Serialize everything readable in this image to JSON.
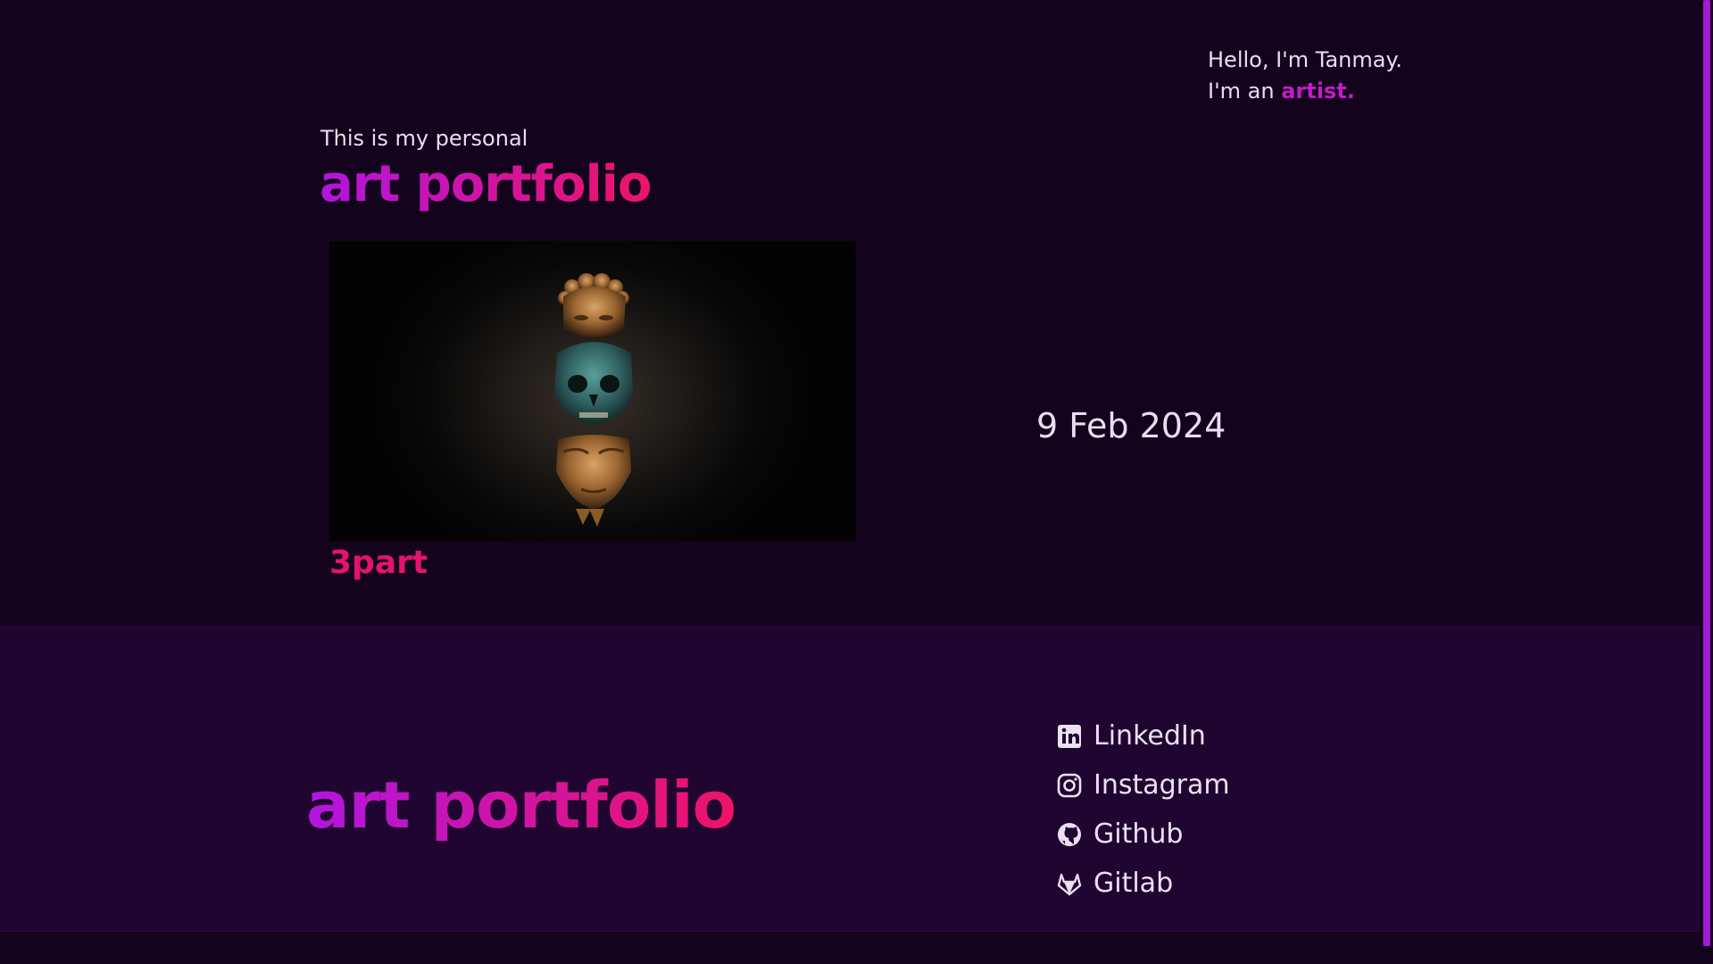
{
  "header": {
    "greeting": "Hello, I'm Tanmay.",
    "role_prefix": "I'm an ",
    "role": "artist."
  },
  "hero": {
    "subtitle": "This is my personal",
    "title": "art portfolio"
  },
  "card": {
    "caption": "3part",
    "date": "9 Feb 2024"
  },
  "footer": {
    "title": "art portfolio",
    "links": [
      {
        "label": "LinkedIn",
        "icon": "linkedin-icon"
      },
      {
        "label": "Instagram",
        "icon": "instagram-icon"
      },
      {
        "label": "Github",
        "icon": "github-icon"
      },
      {
        "label": "Gitlab",
        "icon": "gitlab-icon"
      }
    ]
  },
  "colors": {
    "background": "#13031d",
    "footer_background": "#1f0530",
    "gradient_start": "#b215df",
    "gradient_end": "#ee1466",
    "caption": "#e6136a",
    "scrollbar": "#a319d6"
  }
}
